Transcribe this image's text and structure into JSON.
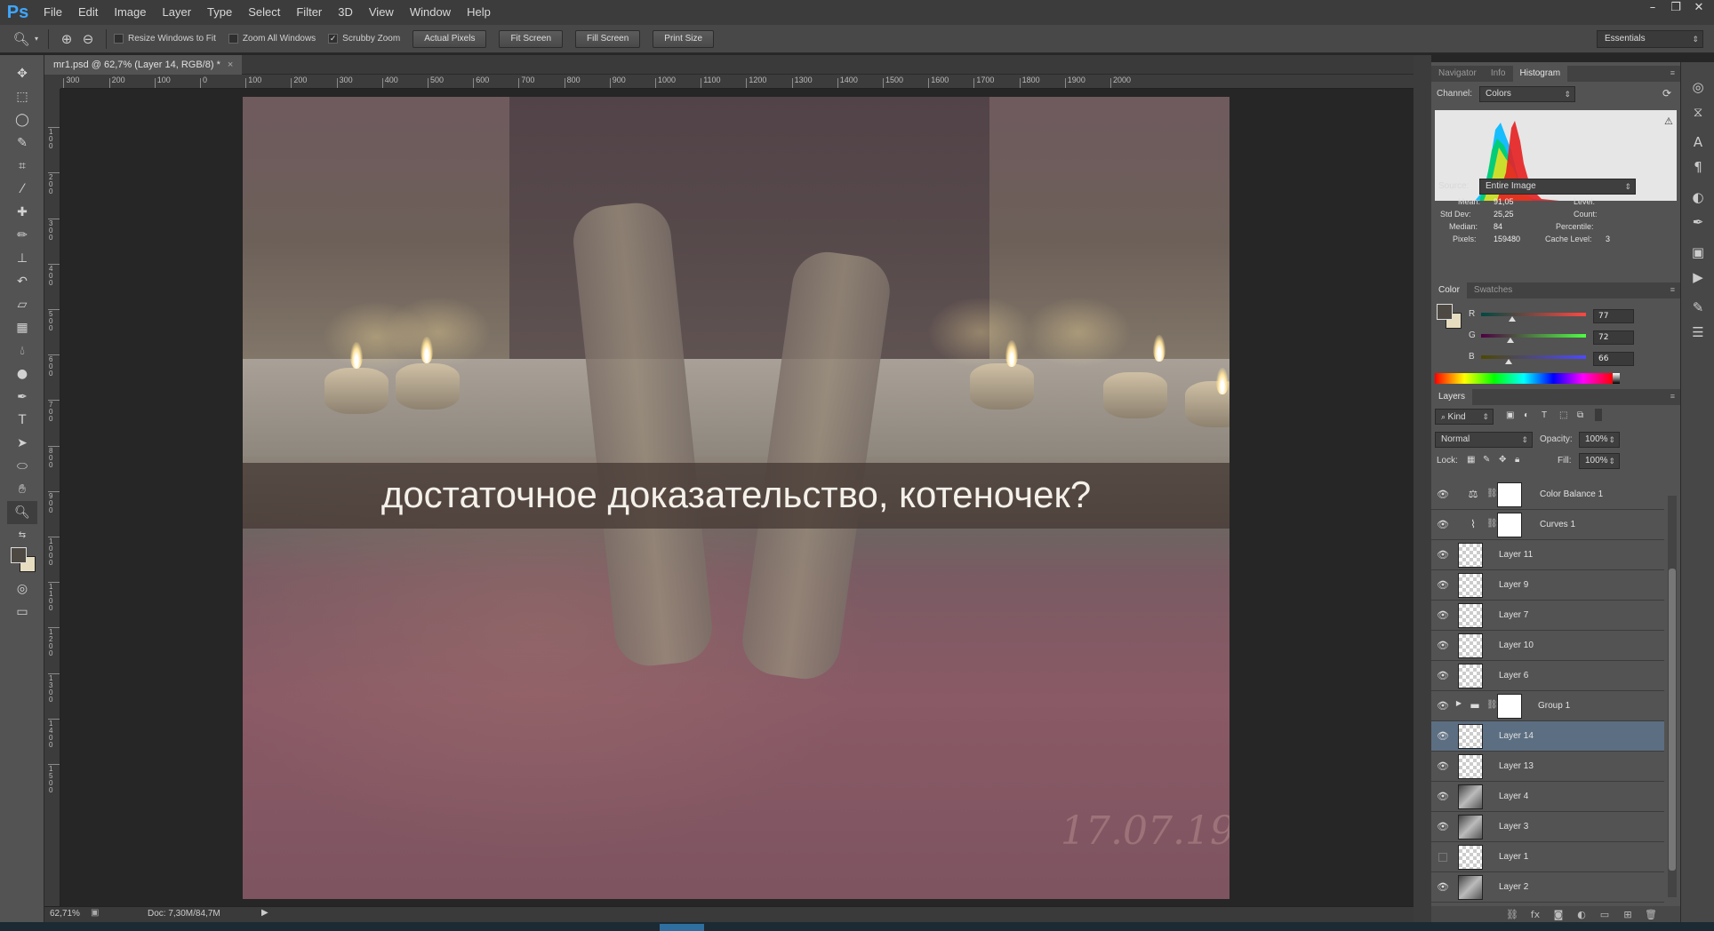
{
  "app": {
    "logo": "Ps"
  },
  "menu": [
    "File",
    "Edit",
    "Image",
    "Layer",
    "Type",
    "Select",
    "Filter",
    "3D",
    "View",
    "Window",
    "Help"
  ],
  "window_controls": [
    "–",
    "❐",
    "✕"
  ],
  "options": {
    "tool_icon": "zoom-icon",
    "resize_windows": "Resize Windows to Fit",
    "zoom_all": "Zoom All Windows",
    "scrubby": "Scrubby Zoom",
    "scrubby_checked": true,
    "actual_pixels": "Actual Pixels",
    "fit_screen": "Fit Screen",
    "fill_screen": "Fill Screen",
    "print_size": "Print Size",
    "workspace": "Essentials"
  },
  "document": {
    "tab": "mr1.psd @ 62,7% (Layer 14, RGB/8) *",
    "caption": "достаточное доказательство, котеночек?",
    "signature": "17.07.19"
  },
  "ruler": {
    "h": [
      "300",
      "200",
      "100",
      "0",
      "100",
      "200",
      "300",
      "400",
      "500",
      "600",
      "700",
      "800",
      "900",
      "1000",
      "1100",
      "1200",
      "1300",
      "1400",
      "1500",
      "1600",
      "1700",
      "1800",
      "1900",
      "2000"
    ],
    "v": [
      "0",
      "100",
      "200",
      "300",
      "400",
      "500",
      "600",
      "700",
      "800",
      "900",
      "1000",
      "1100",
      "1200",
      "1300",
      "1400",
      "1500"
    ]
  },
  "status": {
    "zoom": "62,71%",
    "doc": "Doc: 7,30M/84,7M"
  },
  "histogram": {
    "tabs": [
      "Navigator",
      "Info",
      "Histogram"
    ],
    "channel_label": "Channel:",
    "channel": "Colors",
    "source_label": "Source:",
    "source": "Entire Image",
    "stats": {
      "mean_l": "Mean:",
      "mean": "91,05",
      "std_l": "Std Dev:",
      "std": "25,25",
      "median_l": "Median:",
      "median": "84",
      "pixels_l": "Pixels:",
      "pixels": "159480",
      "level_l": "Level:",
      "count_l": "Count:",
      "percentile_l": "Percentile:",
      "cache_l": "Cache Level:",
      "cache": "3"
    }
  },
  "color": {
    "tabs": [
      "Color",
      "Swatches"
    ],
    "r_label": "R",
    "r": "77",
    "g_label": "G",
    "g": "72",
    "b_label": "B",
    "b": "66",
    "r_fraction": 0.3,
    "g_fraction": 0.28,
    "b_fraction": 0.26,
    "fg": "#4d4842",
    "bg": "#e6dcc0"
  },
  "layers": {
    "tab": "Layers",
    "kind": "Kind",
    "blend": "Normal",
    "opacity_label": "Opacity:",
    "opacity": "100%",
    "lock_label": "Lock:",
    "fill_label": "Fill:",
    "fill": "100%",
    "items": [
      {
        "name": "Color Balance 1",
        "type": "adjust",
        "icon": "balance-icon",
        "visible": true
      },
      {
        "name": "Curves 1",
        "type": "adjust",
        "icon": "curves-icon",
        "visible": true
      },
      {
        "name": "Layer 11",
        "type": "layer",
        "visible": true
      },
      {
        "name": "Layer 9",
        "type": "layer",
        "visible": true
      },
      {
        "name": "Layer 7",
        "type": "layer",
        "visible": true
      },
      {
        "name": "Layer 10",
        "type": "layer",
        "visible": true
      },
      {
        "name": "Layer 6",
        "type": "layer",
        "visible": true
      },
      {
        "name": "Group 1",
        "type": "group",
        "visible": true
      },
      {
        "name": "Layer 14",
        "type": "layer",
        "visible": true,
        "selected": true
      },
      {
        "name": "Layer 13",
        "type": "layer",
        "visible": true
      },
      {
        "name": "Layer 4",
        "type": "art",
        "visible": true
      },
      {
        "name": "Layer 3",
        "type": "art",
        "visible": true
      },
      {
        "name": "Layer 1",
        "type": "layer",
        "visible": false
      },
      {
        "name": "Layer 2",
        "type": "art",
        "visible": true
      }
    ]
  }
}
